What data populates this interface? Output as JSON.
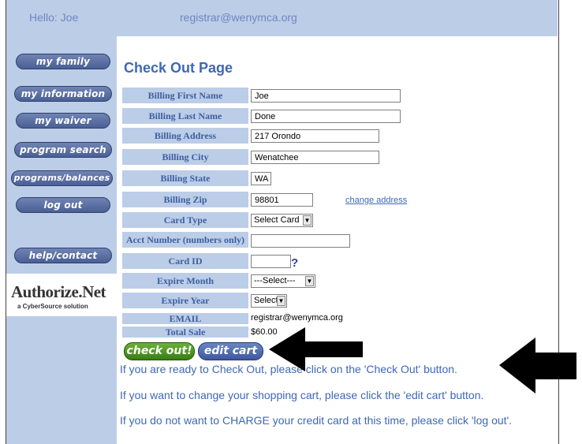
{
  "header": {
    "greeting": "Hello: Joe",
    "email": "registrar@wenymca.org"
  },
  "nav": {
    "my_family": "my family",
    "my_information": "my information",
    "my_waiver": "my waiver",
    "program_search": "program search",
    "programs_balances": "programs/balances",
    "log_out": "log out",
    "help_contact": "help/contact"
  },
  "authorize": {
    "name": "Authorize.Net",
    "tagline": "a CyberSource solution"
  },
  "page": {
    "title": "Check Out Page"
  },
  "form": {
    "first_name": {
      "label": "Billing First Name",
      "value": "Joe"
    },
    "last_name": {
      "label": "Billing Last Name",
      "value": "Done"
    },
    "address": {
      "label": "Billing Address",
      "value": "217 Orondo"
    },
    "city": {
      "label": "Billing City",
      "value": "Wenatchee"
    },
    "state": {
      "label": "Billing State",
      "value": "WA"
    },
    "zip": {
      "label": "Billing Zip",
      "value": "98801",
      "link": "change address"
    },
    "card_type": {
      "label": "Card Type",
      "value": "Select Card"
    },
    "acct_number": {
      "label": "Acct Number (numbers only)",
      "value": ""
    },
    "card_id": {
      "label": "Card ID",
      "value": "",
      "help": "?"
    },
    "expire_month": {
      "label": "Expire Month",
      "value": "---Select---"
    },
    "expire_year": {
      "label": "Expire Year",
      "value": "Select"
    },
    "email": {
      "label": "EMAIL",
      "value": "registrar@wenymca.org"
    },
    "total": {
      "label": "Total Sale",
      "value": "$60.00"
    }
  },
  "actions": {
    "check_out": "check out!",
    "edit_cart": "edit cart"
  },
  "messages": [
    "If you are ready to Check Out, please click on the 'Check Out' button.",
    "If you want to change your shopping cart, please click the 'edit cart' button.",
    "If you do not want to CHARGE your credit card at this time, please click 'log out'."
  ],
  "colors": {
    "header_bg": "#bccde7",
    "label_text": "#3d5fa2",
    "message_text": "#3e68b6",
    "checkout_green": "#4a9a22",
    "edit_blue": "#4e6ab2"
  }
}
